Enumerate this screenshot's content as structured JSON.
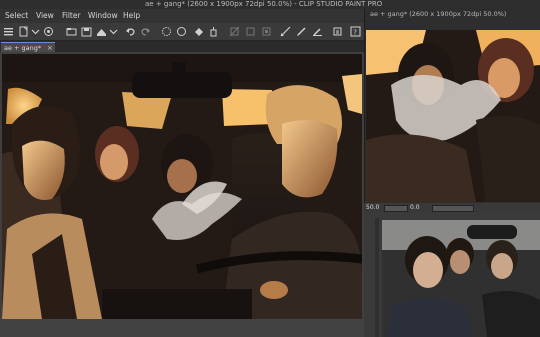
{
  "window": {
    "title": "ae + gang* (2600 x 1900px 72dpi 50.0%)  - CLIP STUDIO PAINT PRO"
  },
  "menu": {
    "items": [
      "Select",
      "View",
      "Filter",
      "Window",
      "Help"
    ]
  },
  "toolbar": {
    "icons": [
      "menu-icon",
      "new-icon",
      "open-icon",
      "save-icon",
      "export-icon",
      "undo-icon",
      "redo-icon",
      "loading-icon",
      "clear-icon",
      "fill-icon",
      "transform-icon",
      "deselect-icon",
      "crop-icon",
      "ruler-icon",
      "pen-icon",
      "edit-icon",
      "settings-icon"
    ]
  },
  "document_tab": {
    "label": "ae + gang*",
    "close": "×"
  },
  "navigator": {
    "title": "ae + gang* (2600 x 1900px 72dpi 50.0%)",
    "zoom": "50.0",
    "rotation": "0.0"
  },
  "colors": {
    "titlebar": "#2d2d2d",
    "panel": "#3b3b3b",
    "accent": "#6a8fd0"
  }
}
